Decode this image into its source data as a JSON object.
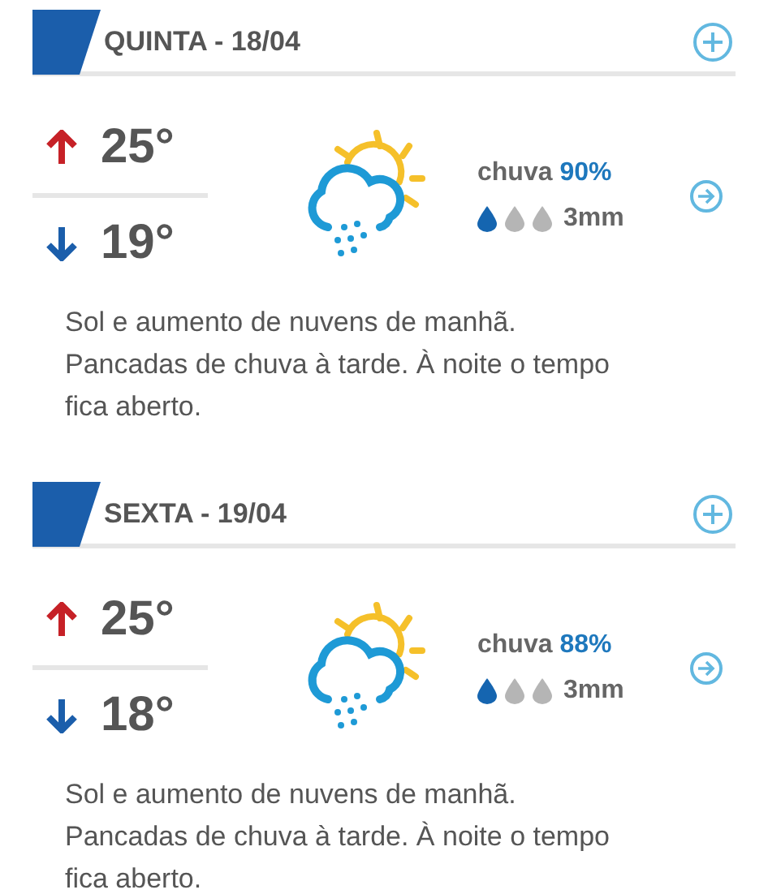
{
  "days": [
    {
      "title": "QUINTA - 18/04",
      "max": "25°",
      "min": "19°",
      "rain_label": "chuva",
      "rain_chance": "90%",
      "drops": [
        {
          "filled": true
        },
        {
          "filled": false
        },
        {
          "filled": false
        }
      ],
      "rain_amount": "3mm",
      "description": "Sol e aumento de nuvens de manhã. Pancadas de chuva à tarde. À noite o tempo fica aberto."
    },
    {
      "title": "SEXTA - 19/04",
      "max": "25°",
      "min": "18°",
      "rain_label": "chuva",
      "rain_chance": "88%",
      "drops": [
        {
          "filled": true
        },
        {
          "filled": false
        },
        {
          "filled": false
        }
      ],
      "rain_amount": "3mm",
      "description": "Sol e aumento de nuvens de manhã. Pancadas de chuva à tarde. À noite o tempo fica aberto."
    }
  ]
}
